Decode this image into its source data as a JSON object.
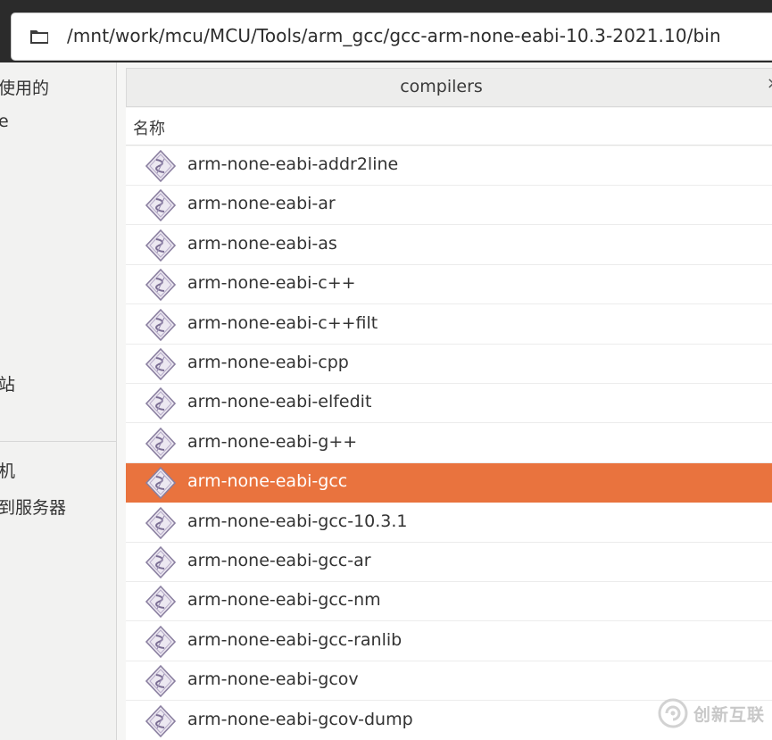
{
  "location": {
    "path": "/mnt/work/mcu/MCU/Tools/arm_gcc/gcc-arm-none-eabi-10.3-2021.10/bin",
    "folder_icon": "folder-icon"
  },
  "sidebar": {
    "items": [
      {
        "label": "使用的"
      },
      {
        "label": "e"
      },
      {
        "label": "站"
      },
      {
        "label": "机"
      },
      {
        "label": "到服务器"
      }
    ]
  },
  "tab": {
    "title": "compilers",
    "close_glyph": "×"
  },
  "columns": {
    "name": "名称"
  },
  "files": [
    {
      "name": "arm-none-eabi-addr2line",
      "icon": "executable-icon"
    },
    {
      "name": "arm-none-eabi-ar",
      "icon": "executable-icon"
    },
    {
      "name": "arm-none-eabi-as",
      "icon": "executable-icon"
    },
    {
      "name": "arm-none-eabi-c++",
      "icon": "executable-icon"
    },
    {
      "name": "arm-none-eabi-c++filt",
      "icon": "executable-icon"
    },
    {
      "name": "arm-none-eabi-cpp",
      "icon": "executable-icon"
    },
    {
      "name": "arm-none-eabi-elfedit",
      "icon": "executable-icon"
    },
    {
      "name": "arm-none-eabi-g++",
      "icon": "executable-icon"
    },
    {
      "name": "arm-none-eabi-gcc",
      "icon": "executable-icon",
      "selected": true
    },
    {
      "name": "arm-none-eabi-gcc-10.3.1",
      "icon": "executable-icon"
    },
    {
      "name": "arm-none-eabi-gcc-ar",
      "icon": "executable-icon"
    },
    {
      "name": "arm-none-eabi-gcc-nm",
      "icon": "executable-icon"
    },
    {
      "name": "arm-none-eabi-gcc-ranlib",
      "icon": "executable-icon"
    },
    {
      "name": "arm-none-eabi-gcov",
      "icon": "executable-icon"
    },
    {
      "name": "arm-none-eabi-gcov-dump",
      "icon": "executable-icon"
    }
  ],
  "colors": {
    "selection": "#e9733e",
    "header": "#2b2b2b"
  },
  "watermark": {
    "text": "创新互联"
  }
}
